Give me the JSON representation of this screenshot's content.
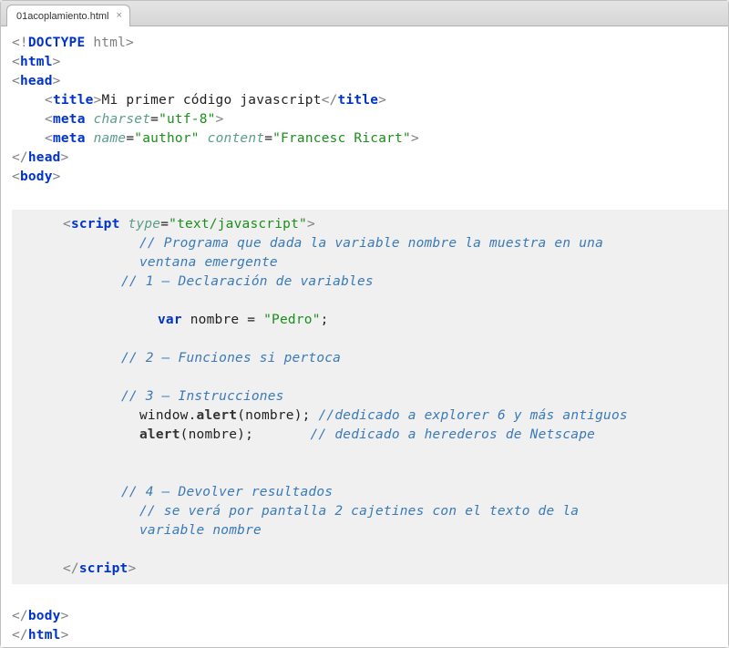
{
  "tab": {
    "filename": "01acoplamiento.html",
    "close_glyph": "×"
  },
  "code": {
    "doctype_open": "<!",
    "doctype_kw": "DOCTYPE",
    "doctype_html": " html",
    "doctype_close": ">",
    "html_open": "html",
    "head_open": "head",
    "title_open": "title",
    "title_text": "Mi primer código javascript",
    "title_close": "title",
    "meta1_tag": "meta",
    "meta1_attr": "charset",
    "meta1_val": "\"utf-8\"",
    "meta2_tag": "meta",
    "meta2_attr1": "name",
    "meta2_val1": "\"author\"",
    "meta2_attr2": "content",
    "meta2_val2": "\"Francesc Ricart\"",
    "head_close": "head",
    "body_open": "body",
    "script_open": "script",
    "script_attr": "type",
    "script_val": "\"text/javascript\"",
    "c1": "// Programa que dada la variable nombre la muestra en una",
    "c1b": "ventana emergente",
    "c2": "// 1 – Declaración de variables",
    "var_kw": "var",
    "var_name": " nombre = ",
    "var_val": "\"Pedro\"",
    "semi": ";",
    "c3": "// 2 – Funciones si pertoca",
    "c4": "// 3 – Instrucciones",
    "window_obj": "window",
    "dot": ".",
    "alert_fn": "alert",
    "call_arg1": "(nombre); ",
    "c5": "//dedicado a explorer 6 y más antiguos",
    "call_arg2": "(nombre);       ",
    "c6": "// dedicado a herederos de Netscape",
    "c7": "// 4 – Devolver resultados",
    "c8": "// se verá por pantalla 2 cajetines con el texto de la",
    "c8b": "variable nombre",
    "script_close": "script",
    "body_close": "body",
    "html_close": "html"
  }
}
